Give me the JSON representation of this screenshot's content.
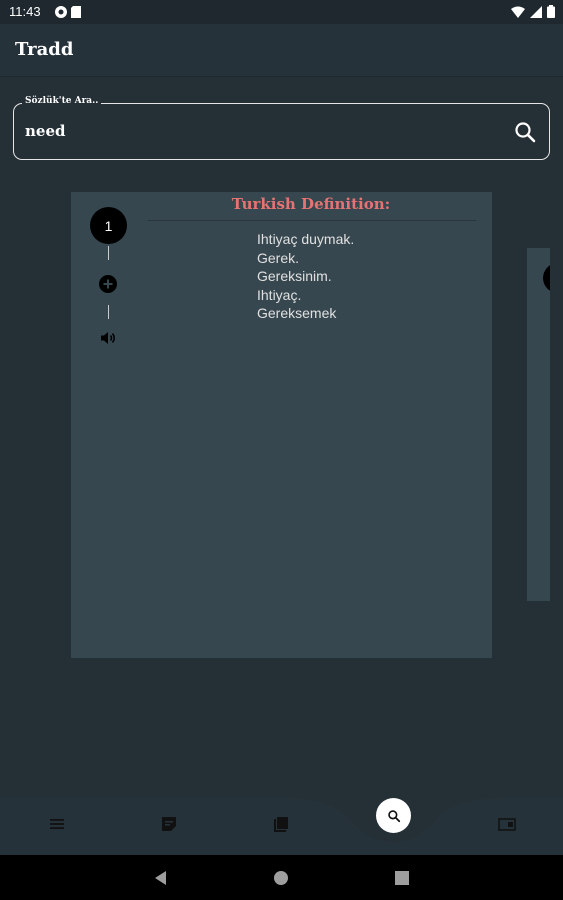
{
  "status": {
    "time": "11:43"
  },
  "app": {
    "title": "Tradd"
  },
  "search": {
    "label": "Sözlük'te Ara..",
    "value": "need"
  },
  "result": {
    "number": "1",
    "heading": "Turkish Definition:",
    "definitions": [
      "Ihtiyaç duymak.",
      "Gerek.",
      "Gereksinim.",
      "Ihtiyaç.",
      "Gereksemek"
    ]
  },
  "nav": {
    "items": [
      "menu-icon",
      "notes-icon",
      "book-icon",
      "search-icon",
      "card-icon"
    ],
    "active": "search-icon"
  },
  "colors": {
    "background": "#252f36",
    "card": "#37474f",
    "accent": "#e57373"
  }
}
